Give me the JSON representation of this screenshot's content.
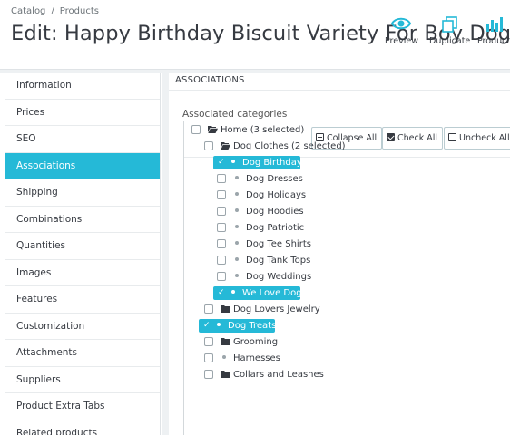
{
  "breadcrumb": {
    "items": [
      "Catalog",
      "Products"
    ],
    "separator": "/"
  },
  "title": "Edit: Happy Birthday Biscuit Variety For Boy Dogs Birthday",
  "toolbar": {
    "preview": "Preview",
    "duplicate": "Duplicate",
    "product": "Product"
  },
  "sidebar": {
    "active": "Associations",
    "items": [
      {
        "label": "Information"
      },
      {
        "label": "Prices"
      },
      {
        "label": "SEO"
      },
      {
        "label": "Associations"
      },
      {
        "label": "Shipping"
      },
      {
        "label": "Combinations"
      },
      {
        "label": "Quantities"
      },
      {
        "label": "Images"
      },
      {
        "label": "Features"
      },
      {
        "label": "Customization"
      },
      {
        "label": "Attachments"
      },
      {
        "label": "Suppliers"
      },
      {
        "label": "Product Extra Tabs"
      },
      {
        "label": "Related products"
      }
    ]
  },
  "panel": {
    "heading": "ASSOCIATIONS",
    "associated_label": "Associated categories",
    "tree_buttons": {
      "collapse": "Collapse All",
      "check": "Check All",
      "uncheck": "Uncheck All"
    }
  },
  "tree": [
    {
      "label": "Home (3 selected)",
      "folder": "open",
      "checked": false
    },
    {
      "label": "Dog Clothes (2 selected)",
      "folder": "open",
      "checked": false
    },
    {
      "label": "Dog Birthdays",
      "folder": "none",
      "checked": true
    },
    {
      "label": "Dog Dresses",
      "folder": "none",
      "checked": false
    },
    {
      "label": "Dog Holidays",
      "folder": "none",
      "checked": false
    },
    {
      "label": "Dog Hoodies",
      "folder": "none",
      "checked": false
    },
    {
      "label": "Dog Patriotic",
      "folder": "none",
      "checked": false
    },
    {
      "label": "Dog Tee Shirts",
      "folder": "none",
      "checked": false
    },
    {
      "label": "Dog Tank Tops",
      "folder": "none",
      "checked": false
    },
    {
      "label": "Dog Weddings",
      "folder": "none",
      "checked": false
    },
    {
      "label": "We Love Dogs",
      "folder": "none",
      "checked": true
    },
    {
      "label": "Dog Lovers Jewelry",
      "folder": "closed",
      "checked": false
    },
    {
      "label": "Dog Treats",
      "folder": "none",
      "checked": true
    },
    {
      "label": "Grooming",
      "folder": "closed",
      "checked": false
    },
    {
      "label": "Harnesses",
      "folder": "none",
      "checked": false
    },
    {
      "label": "Collars and Leashes",
      "folder": "closed",
      "checked": false
    }
  ],
  "colors": {
    "accent": "#25b9d7",
    "text": "#363a41",
    "border": "#dfe3e6"
  }
}
